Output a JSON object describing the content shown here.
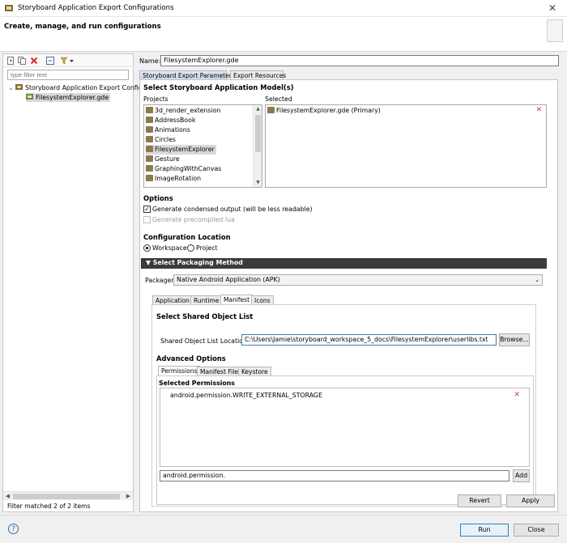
{
  "window": {
    "title": "Storyboard Application Export Configurations",
    "close_glyph": "✕",
    "header": "Create, manage, and run configurations"
  },
  "left": {
    "toolbar_icons": [
      "new-config-icon",
      "duplicate-icon",
      "delete-icon",
      "collapse-all-icon",
      "filter-menu-icon"
    ],
    "filter_placeholder": "type filter text",
    "tree": [
      {
        "label": "Storyboard Application Export Configu",
        "expander": "⌄"
      },
      {
        "label": "FilesystemExplorer.gde"
      }
    ],
    "status": "Filter matched 2 of 2 items"
  },
  "name": {
    "label": "Name:",
    "value": "FilesystemExplorer.gde"
  },
  "tabs": [
    "Storyboard Export Parameters",
    "Export Resources"
  ],
  "model": {
    "title": "Select Storyboard Application Model(s)",
    "projects_label": "Projects",
    "selected_label": "Selected",
    "projects": [
      "3d_render_extension",
      "AddressBook",
      "Animations",
      "Circles",
      "FilesystemExplorer",
      "Gesture",
      "GraphingWithCanvas",
      "ImageRotation"
    ],
    "selected_project": "FilesystemExplorer",
    "selected_items": [
      "FilesystemExplorer.gde (Primary)"
    ]
  },
  "options": {
    "title": "Options",
    "condensed": "Generate condensed output (will be less readable)",
    "precompiled": "Generate precompiled lua"
  },
  "location": {
    "title": "Configuration Location",
    "workspace": "Workspace",
    "project": "Project"
  },
  "packaging": {
    "bar_title": "Select Packaging Method",
    "packager_label": "Packager:",
    "packager_value": "Native Android Application (APK)",
    "subtabs": [
      "Application",
      "Runtime",
      "Manifest",
      "Icons"
    ],
    "active_subtab": "Manifest"
  },
  "manifest": {
    "shared_title": "Select Shared Object List",
    "shared_label": "Shared Object List Location:",
    "shared_value": "C:\\Users\\Jamie\\storyboard_workspace_5_docs\\FilesystemExplorer\\userlibs.txt",
    "browse": "Browse...",
    "advanced_title": "Advanced Options",
    "adv_tabs": [
      "Permissions",
      "Manifest File",
      "Keystore"
    ],
    "perm_title": "Selected Permissions",
    "permissions": [
      "android.permission.WRITE_EXTERNAL_STORAGE"
    ],
    "perm_input": "android.permission.",
    "add": "Add"
  },
  "buttons": {
    "revert": "Revert",
    "apply": "Apply",
    "run": "Run",
    "close": "Close",
    "help": "?"
  }
}
